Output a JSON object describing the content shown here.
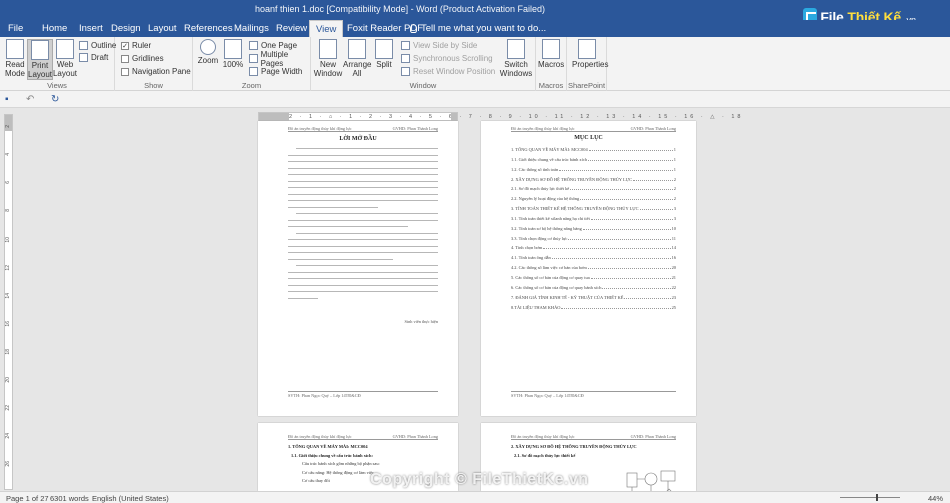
{
  "window": {
    "title": "hoanf thien 1.doc [Compatibility Mode] - Word (Product Activation Failed)"
  },
  "logo": {
    "brand_a": "File",
    "brand_b": "Thiết Kế",
    "domain": ".vn"
  },
  "tabs": [
    "File",
    "Home",
    "Insert",
    "Design",
    "Layout",
    "References",
    "Mailings",
    "Review",
    "View",
    "Foxit Reader PDF"
  ],
  "active_tab": "View",
  "tell_me": "Tell me what you want to do...",
  "ribbon": {
    "views": {
      "label": "Views",
      "read_mode": "Read Mode",
      "print_layout": "Print Layout",
      "web_layout": "Web Layout",
      "outline": "Outline",
      "draft": "Draft"
    },
    "show": {
      "label": "Show",
      "ruler": "Ruler",
      "gridlines": "Gridlines",
      "nav_pane": "Navigation Pane"
    },
    "zoom": {
      "label": "Zoom",
      "zoom": "Zoom",
      "hundred": "100%",
      "one_page": "One Page",
      "multiple_pages": "Multiple Pages",
      "page_width": "Page Width"
    },
    "window": {
      "label": "Window",
      "new_window": "New Window",
      "arrange_all": "Arrange All",
      "split": "Split",
      "side_by_side": "View Side by Side",
      "sync_scroll": "Synchronous Scrolling",
      "reset_pos": "Reset Window Position",
      "switch_windows": "Switch Windows"
    },
    "macros": {
      "label": "Macros",
      "macros": "Macros"
    },
    "sharepoint": {
      "label": "SharePoint",
      "properties": "Properties"
    }
  },
  "ruler_ticks": "2 · 1 · ⌂ · 1 · 2 · 3 · 4 · 5 · 6 · 7 · 8 · 9 · 10 · 11 · 12 · 13 · 14 · 15 · 16 · △ · 18",
  "vruler": [
    "2",
    "4",
    "6",
    "8",
    "10",
    "12",
    "14",
    "16",
    "18",
    "20",
    "22",
    "24",
    "26"
  ],
  "page1": {
    "header_left": "Đồ án truyền động thủy khí động lực",
    "header_right": "GVHD: Phan Thành Long",
    "title": "LỜI MỞ ĐẦU",
    "sign": "Sinh viên thực hiện",
    "footer": "SVTH: Phan Ngọc Quý – Lớp 14TĐ&CĐ"
  },
  "page2": {
    "header_left": "Đồ án truyền động thủy khí động lực",
    "header_right": "GVHD: Phan Thành Long",
    "title": "MỤC LỤC",
    "footer": "SVTH: Phan Ngọc Quý – Lớp 14TĐ&CĐ",
    "toc": [
      {
        "t": "1. TỔNG QUAN VỀ MÁY MÀI: MCC004",
        "n": "1"
      },
      {
        "t": "1.1. Giới thiệu chung về cấu trúc bánh xích",
        "n": "1"
      },
      {
        "t": "1.2. Các thông số tính toán",
        "n": "1"
      },
      {
        "t": "2. XÂY DỰNG SƠ ĐỒ HỆ THỐNG TRUYỀN ĐỘNG THỦY LỰC",
        "n": "2"
      },
      {
        "t": "2.1. Sơ đồ mạch thủy lực thiết kế",
        "n": "2"
      },
      {
        "t": "2.2. Nguyên lý hoạt động của hệ thống",
        "n": "2"
      },
      {
        "t": "3. TÍNH TOÁN THIẾT KẾ HỆ THỐNG TRUYỀN ĐỘNG THỦY LỰC",
        "n": "3"
      },
      {
        "t": "3.1. Tính toán thiết kế xilanh nâng hạ chi tiết",
        "n": "3"
      },
      {
        "t": "3.2. Tính toán sơ bộ hệ thống nâng bàng",
        "n": "10"
      },
      {
        "t": "3.3. Tính chọn động cơ thủy lực",
        "n": "11"
      },
      {
        "t": "4. Tính chọn bơm",
        "n": "14"
      },
      {
        "t": "4.1. Tính toán ống dẫn",
        "n": "16"
      },
      {
        "t": "4.2. Các thông số làm việc cơ bản của bơm",
        "n": "20"
      },
      {
        "t": "5. Các thông số cơ bản của động cơ quay tua",
        "n": "21"
      },
      {
        "t": "6. Các thông số cơ bản của động cơ quay bánh xích",
        "n": "22"
      },
      {
        "t": "7. ĐÁNH GIÁ TÍNH KINH TẾ - KỸ THUẬT CỦA THIẾT KẾ",
        "n": "23"
      },
      {
        "t": "8.TÀI LIỆU THAM KHẢO",
        "n": "25"
      }
    ]
  },
  "page3": {
    "header_left": "Đồ án truyền động thủy khí động lực",
    "header_right": "GVHD: Phan Thành Long",
    "h1": "1. TỔNG QUAN VỀ MÁY MÀI: MCC004",
    "h2": "1.1. Giới thiệu chung về cấu trúc bánh xích:",
    "l1": "Cấu trúc bánh xích gồm những bộ phận sau:",
    "l2": "Cơ cấu nâng: Hệ thống động cơ làm việc",
    "l3": "Cơ cấu thay đổi"
  },
  "page4": {
    "header_left": "Đồ án truyền động thủy khí động lực",
    "header_right": "GVHD: Phan Thành Long",
    "h1": "2. XÂY DỰNG SƠ ĐỒ HỆ THỐNG TRUYỀN ĐỘNG THỦY LỰC",
    "h2": "2.1. Sơ đồ mạch thủy lực thiết kế"
  },
  "status": {
    "page": "Page 1 of 27",
    "words": "6301 words",
    "lang": "English (United States)",
    "zoom": "44%"
  },
  "watermark": "Copyright © FileThietKe.vn"
}
